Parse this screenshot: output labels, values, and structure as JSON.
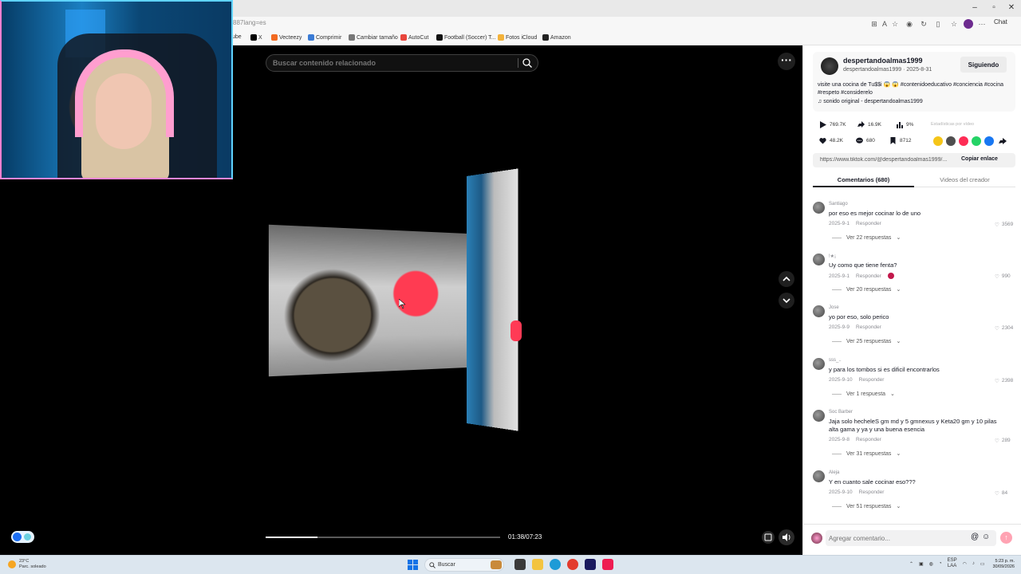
{
  "browser": {
    "url": "887lang=es",
    "chat_label": "Chat",
    "bookmarks": [
      {
        "label": "ube",
        "color": "#ffffff"
      },
      {
        "label": "X",
        "color": "#000000"
      },
      {
        "label": "Vecteezy",
        "color": "#f26a21"
      },
      {
        "label": "Comprimir",
        "color": "#3a7bd5"
      },
      {
        "label": "Cambiar tamaño",
        "color": "#777777"
      },
      {
        "label": "AutoCut",
        "color": "#e8453c"
      },
      {
        "label": "Football (Soccer) T...",
        "color": "#111111"
      },
      {
        "label": "Fotos iCloud",
        "color": "#f3b23a"
      },
      {
        "label": "Amazon",
        "color": "#222222"
      }
    ],
    "colors": {
      "accent": "#fe2c55",
      "tab_underline": "#161823"
    }
  },
  "video": {
    "search_placeholder": "Buscar contenido relacionado",
    "time": "01:38/07:23",
    "progress": 0.22
  },
  "post": {
    "username": "despertandoalmas1999",
    "subline": "despertandoalmas1999 · 2025-8-31",
    "follow_label": "Siguiendo",
    "description": "visite una cocina de Tu$$i 😱 😱 #contenidoeducativo #conciencia #cocina #respeto #considerelo",
    "sound": "♫ sonido original - despertandoalmas1999",
    "plays": "769.7K",
    "shares": "16.9K",
    "stats_percent": "9%",
    "stats_label": "Estadísticas por vídeo",
    "likes": "48.2K",
    "comments_count": "680",
    "saves": "8712",
    "link": "https://www.tiktok.com/@despertandoalmas1999/...",
    "copy_label": "Copiar enlace"
  },
  "tabs": {
    "comments": "Comentarios (680)",
    "videos": "Videos del creador"
  },
  "comments": [
    {
      "name": "Santiago",
      "text": "por eso es mejor cocinar lo de uno",
      "date": "2025-9-1",
      "reply": "Responder",
      "likes": "3569",
      "replies": "Ver 22 respuestas"
    },
    {
      "name": "!★¡",
      "text": "Uy como que tiene fenta?",
      "date": "2025-9-1",
      "reply": "Responder",
      "likes": "990",
      "replies": "Ver 20 respuestas"
    },
    {
      "name": "Jose",
      "text": "yo por eso, solo perico",
      "date": "2025-9-9",
      "reply": "Responder",
      "likes": "2304",
      "replies": "Ver 25 respuestas"
    },
    {
      "name": "sss_..",
      "text": "y para los tombos si es dificil encontrarlos",
      "date": "2025-9-10",
      "reply": "Responder",
      "likes": "2398",
      "replies": "Ver 1 respuesta"
    },
    {
      "name": "Soc Barber",
      "text": "Jaja solo hecheleS gm md y 5 gmnexus y Keta20 gm y 10 pilas alta gama y ya y una buena esencia",
      "date": "2025-9-8",
      "reply": "Responder",
      "likes": "289",
      "replies": "Ver 31 respuestas"
    },
    {
      "name": "Aleja",
      "text": "Y en cuanto sale cocinar eso???",
      "date": "2025-9-10",
      "reply": "Responder",
      "likes": "84",
      "replies": "Ver 51 respuestas"
    }
  ],
  "comment_box": {
    "placeholder": "Agregar comentario..."
  },
  "taskbar": {
    "temp": "23°C",
    "weather": "Parc. soleado",
    "search_label": "Buscar",
    "lang": "ESP",
    "lang2": "LAA",
    "time": "5:23 p. m.",
    "date": "30/09/2026"
  }
}
